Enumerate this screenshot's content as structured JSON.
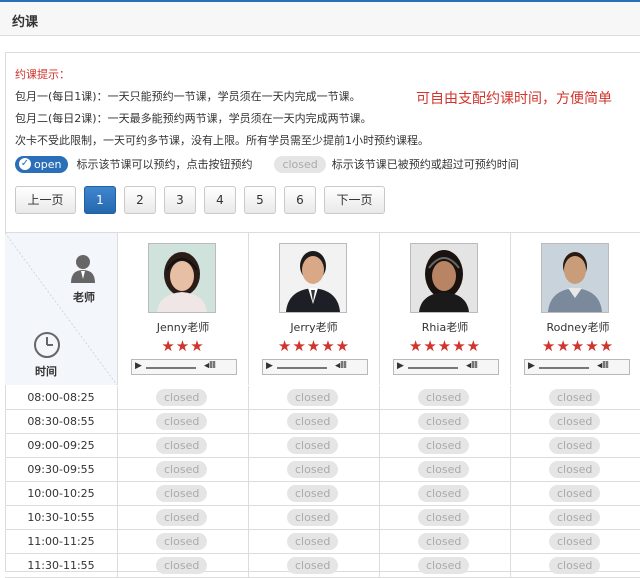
{
  "header": {
    "title": "约课"
  },
  "tips": {
    "heading": "约课提示：",
    "lines": [
      "包月一(每日1课)：一天只能预约一节课，学员须在一天内完成一节课。",
      "包月二(每日2课)：一天最多能预约两节课，学员须在一天内完成两节课。",
      "次卡不受此限制，一天可约多节课，没有上限。所有学员需至少提前1小时预约课程。"
    ],
    "promo": "可自由支配约课时间，方便简单"
  },
  "legend": {
    "open_label": "open",
    "open_desc": "标示该节课可以预约，点击按钮预约",
    "closed_label": "closed",
    "closed_desc": "标示该节课已被预约或超过可预约时间"
  },
  "pager": {
    "prev": "上一页",
    "pages": [
      "1",
      "2",
      "3",
      "4",
      "5",
      "6"
    ],
    "active": "1",
    "next": "下一页"
  },
  "grid": {
    "teacher_header": "老师",
    "time_header": "时间",
    "teachers": [
      {
        "name": "Jenny老师",
        "rating": 3
      },
      {
        "name": "Jerry老师",
        "rating": 5
      },
      {
        "name": "Rhia老师",
        "rating": 5
      },
      {
        "name": "Rodney老师",
        "rating": 5
      }
    ],
    "status_label": "closed",
    "slots": [
      {
        "time": "08:00-08:25",
        "status": [
          "closed",
          "closed",
          "closed",
          "closed"
        ]
      },
      {
        "time": "08:30-08:55",
        "status": [
          "closed",
          "closed",
          "closed",
          "closed"
        ]
      },
      {
        "time": "09:00-09:25",
        "status": [
          "closed",
          "closed",
          "closed",
          "closed"
        ]
      },
      {
        "time": "09:30-09:55",
        "status": [
          "closed",
          "closed",
          "closed",
          "closed"
        ]
      },
      {
        "time": "10:00-10:25",
        "status": [
          "closed",
          "closed",
          "closed",
          "closed"
        ]
      },
      {
        "time": "10:30-10:55",
        "status": [
          "closed",
          "closed",
          "closed",
          "closed"
        ]
      },
      {
        "time": "11:00-11:25",
        "status": [
          "closed",
          "closed",
          "closed",
          "closed"
        ]
      },
      {
        "time": "11:30-11:55",
        "status": [
          "closed",
          "closed",
          "closed",
          "closed"
        ]
      }
    ]
  },
  "colors": {
    "accent": "#2a6fb8",
    "tip_red": "#d0342c",
    "star_red": "#d0342c"
  }
}
